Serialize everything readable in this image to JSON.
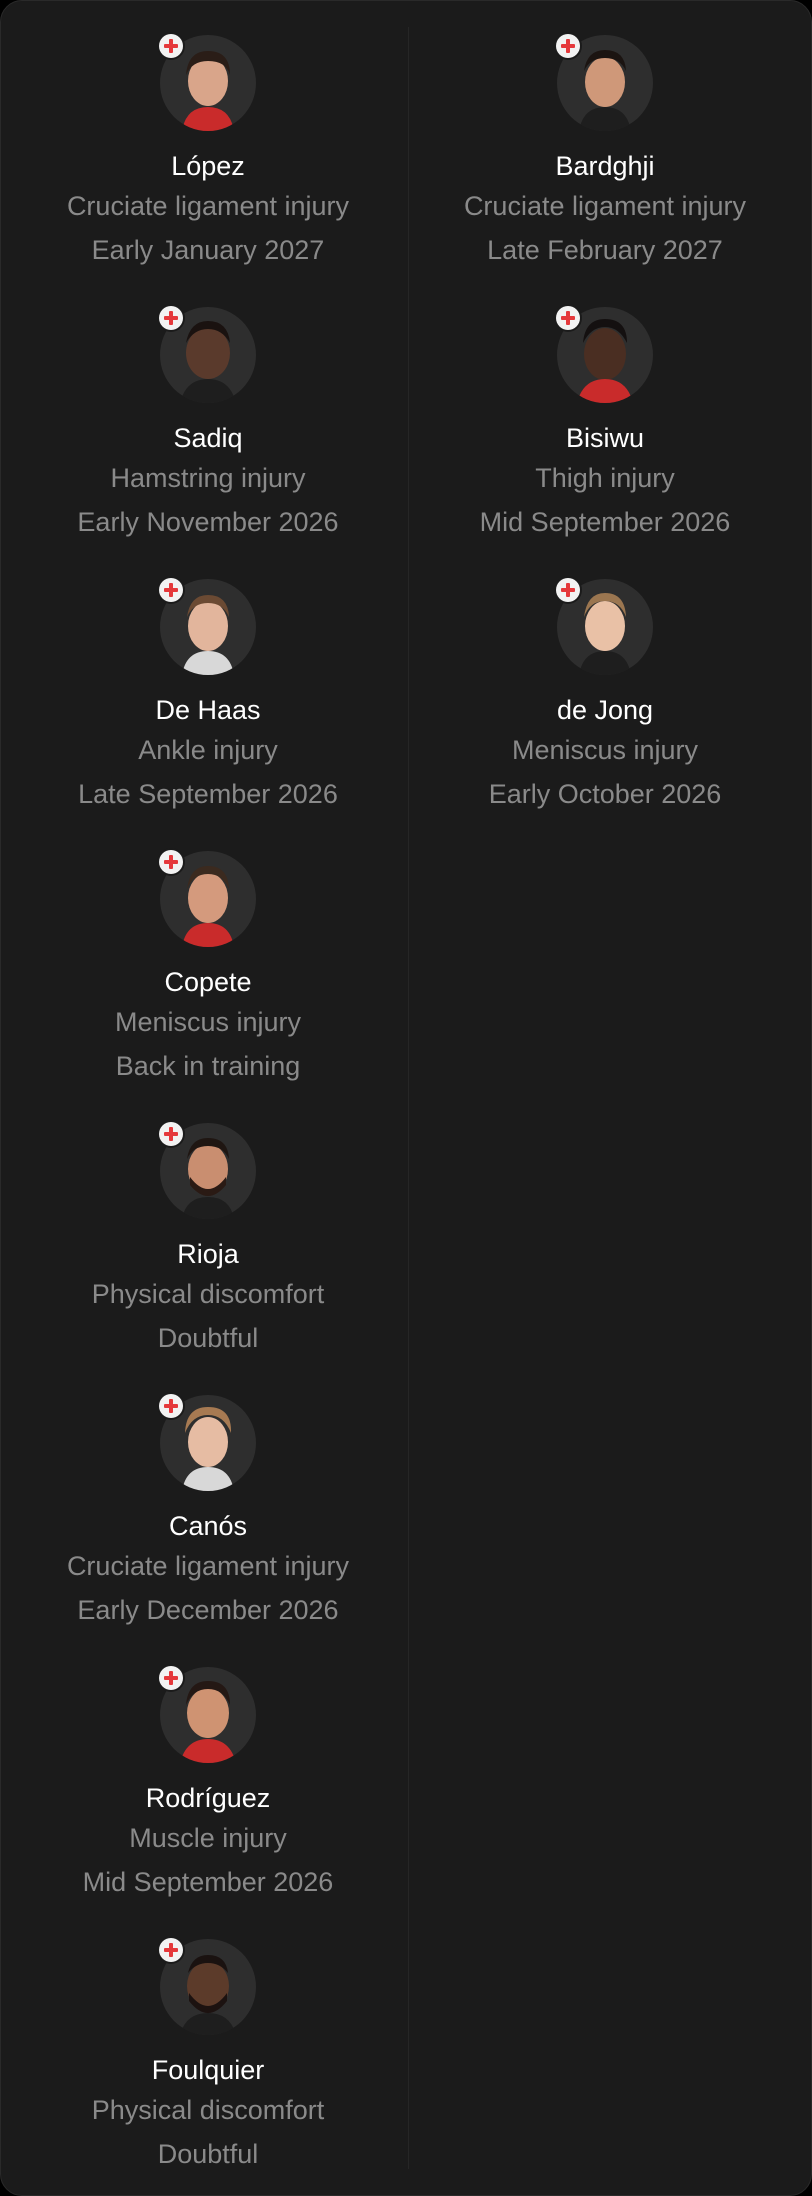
{
  "accent": {
    "badge_bg": "#f2f2f2",
    "badge_cross": "#e5383b",
    "name_color": "#ffffff",
    "detail_color": "#8a8a8a",
    "card_bg": "#1b1b1b"
  },
  "left_column": [
    {
      "name": "López",
      "injury": "Cruciate ligament injury",
      "return": "Early January 2027",
      "icon": "injury-cross-icon"
    },
    {
      "name": "Sadiq",
      "injury": "Hamstring injury",
      "return": "Early November 2026",
      "icon": "injury-cross-icon"
    },
    {
      "name": "De Haas",
      "injury": "Ankle injury",
      "return": "Late September 2026",
      "icon": "injury-cross-icon"
    },
    {
      "name": "Copete",
      "injury": "Meniscus injury",
      "return": "Back in training",
      "icon": "injury-cross-icon"
    },
    {
      "name": "Rioja",
      "injury": "Physical discomfort",
      "return": "Doubtful",
      "icon": "injury-cross-icon"
    },
    {
      "name": "Canós",
      "injury": "Cruciate ligament injury",
      "return": "Early December 2026",
      "icon": "injury-cross-icon"
    },
    {
      "name": "Rodríguez",
      "injury": "Muscle injury",
      "return": "Mid September 2026",
      "icon": "injury-cross-icon"
    },
    {
      "name": "Foulquier",
      "injury": "Physical discomfort",
      "return": "Doubtful",
      "icon": "injury-cross-icon"
    }
  ],
  "right_column": [
    {
      "name": "Bardghji",
      "injury": "Cruciate ligament injury",
      "return": "Late February 2027",
      "icon": "injury-cross-icon"
    },
    {
      "name": "Bisiwu",
      "injury": "Thigh injury",
      "return": "Mid September 2026",
      "icon": "injury-cross-icon"
    },
    {
      "name": "de Jong",
      "injury": "Meniscus injury",
      "return": "Early October 2026",
      "icon": "injury-cross-icon"
    }
  ]
}
